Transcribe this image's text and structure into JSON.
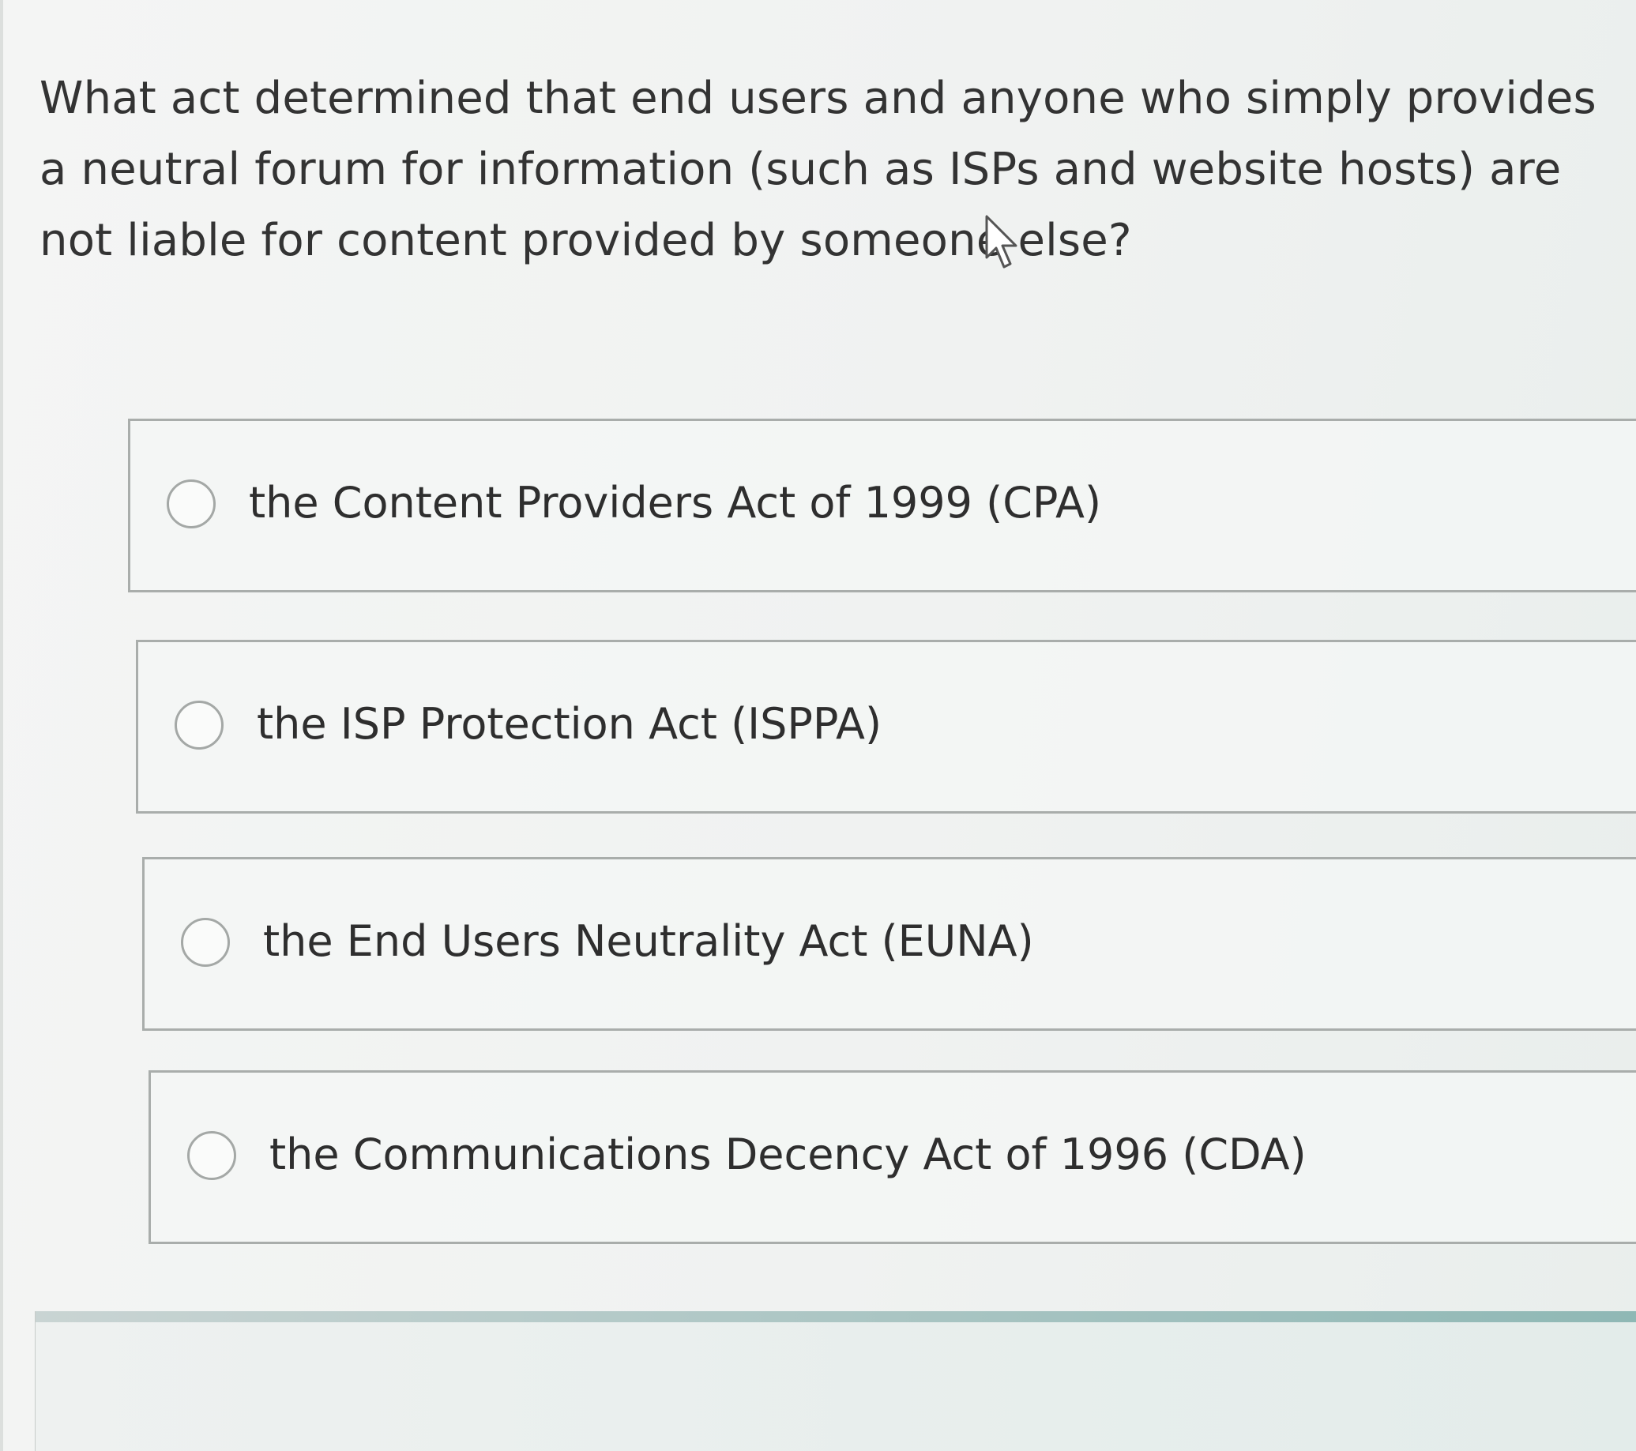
{
  "question": {
    "text": "What act determined that end users and anyone who simply provides a neutral forum for information (such as ISPs and website hosts) are not liable for content provided by someone else?"
  },
  "options": [
    {
      "label": "the Content Providers Act of 1999 (CPA)",
      "selected": false
    },
    {
      "label": "the ISP Protection Act (ISPPA)",
      "selected": false
    },
    {
      "label": "the End Users Neutrality Act (EUNA)",
      "selected": false
    },
    {
      "label": "the Communications Decency Act of 1996 (CDA)",
      "selected": false
    }
  ],
  "icons": {
    "pointer": "mouse-pointer-icon",
    "radio": "radio-unchecked-icon"
  },
  "colors": {
    "background": "#f4f5f4",
    "border": "#a9adab",
    "text": "#2e2e2e",
    "accent_bar": "#8fb8b5"
  }
}
